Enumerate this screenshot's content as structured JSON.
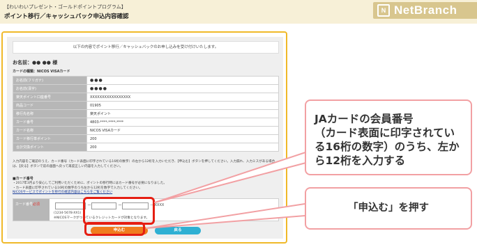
{
  "header": {
    "subtitle": "【わいわいプレゼント・ゴールドポイントプログラム】",
    "title": "ポイント移行／キャッシュバック申込内容確認",
    "logo_text": "NetBranch",
    "logo_mark": "N"
  },
  "form": {
    "notice": "以下の内容でポイント移行／キャッシュバックのお申し込みを受け付けいたします。",
    "greeting": "お名前：●● ●● 様",
    "card_type": "カードの種類：NICOS VISAカード",
    "rows": [
      {
        "label": "お名前(フリガナ)",
        "value": "●●●"
      },
      {
        "label": "お名前(漢字)",
        "value": "●●●●"
      },
      {
        "label": "楽天ポイント口座番号",
        "value": "XXXXXXXXXXXXXXXXX"
      },
      {
        "label": "商品コード",
        "value": "01905"
      },
      {
        "label": "移行先名称",
        "value": "楽天ポイント"
      },
      {
        "label": "カード番号",
        "value": "4803-****-****-****"
      },
      {
        "label": "カード名称",
        "value": "NICOS VISAカード"
      },
      {
        "label": "カード移行単ポイント",
        "value": "200"
      },
      {
        "label": "合計交換ポイント",
        "value": "200"
      }
    ],
    "instruction": "入力内容をご確認のうえ、カード番号（カード表面に印字されている16桁の数字）の左から12桁を入力いただき、【申込む】ボタンを押してください。入力漏れ、入力ミスがある場合は、【戻る】ボタンで前の画面へ戻って再度正しい内容を入力してください。",
    "section_title": "■カード番号",
    "notes": [
      "・2017年3月より安心してご利用いただくために、ポイントの移行時にはカード番号が必要になりました。",
      "・カード表面に印字されている16桁の数字のうち左から12桁を数字で入力してください。"
    ],
    "nicos_link": "NICOSサービスでポイントを移行の確認内容はこちらをご覧ください",
    "card_label": "カード番号",
    "required_mark": "必須",
    "masked_suffix": "－ XXXX",
    "hyphen": "－",
    "example": "(1234-5678-XX1)",
    "nicos_note": "※NICOSマークがついているクレジットカードが対象となります。",
    "submit_label": "申込む",
    "back_label": "戻る"
  },
  "callouts": {
    "card_number_lines": [
      "JAカードの会員番号",
      "（カード表面に印字されてい",
      "る16桁の数字）のうち、左か",
      "ら12桁を入力する"
    ],
    "submit_instruction": "「申込む」を押す"
  },
  "colors": {
    "highlight": "#e51e12",
    "panel_border": "#f0b929",
    "submit_button": "#f07c1e",
    "back_button": "#2fb0d3",
    "callout_border": "#f2a0a3"
  }
}
